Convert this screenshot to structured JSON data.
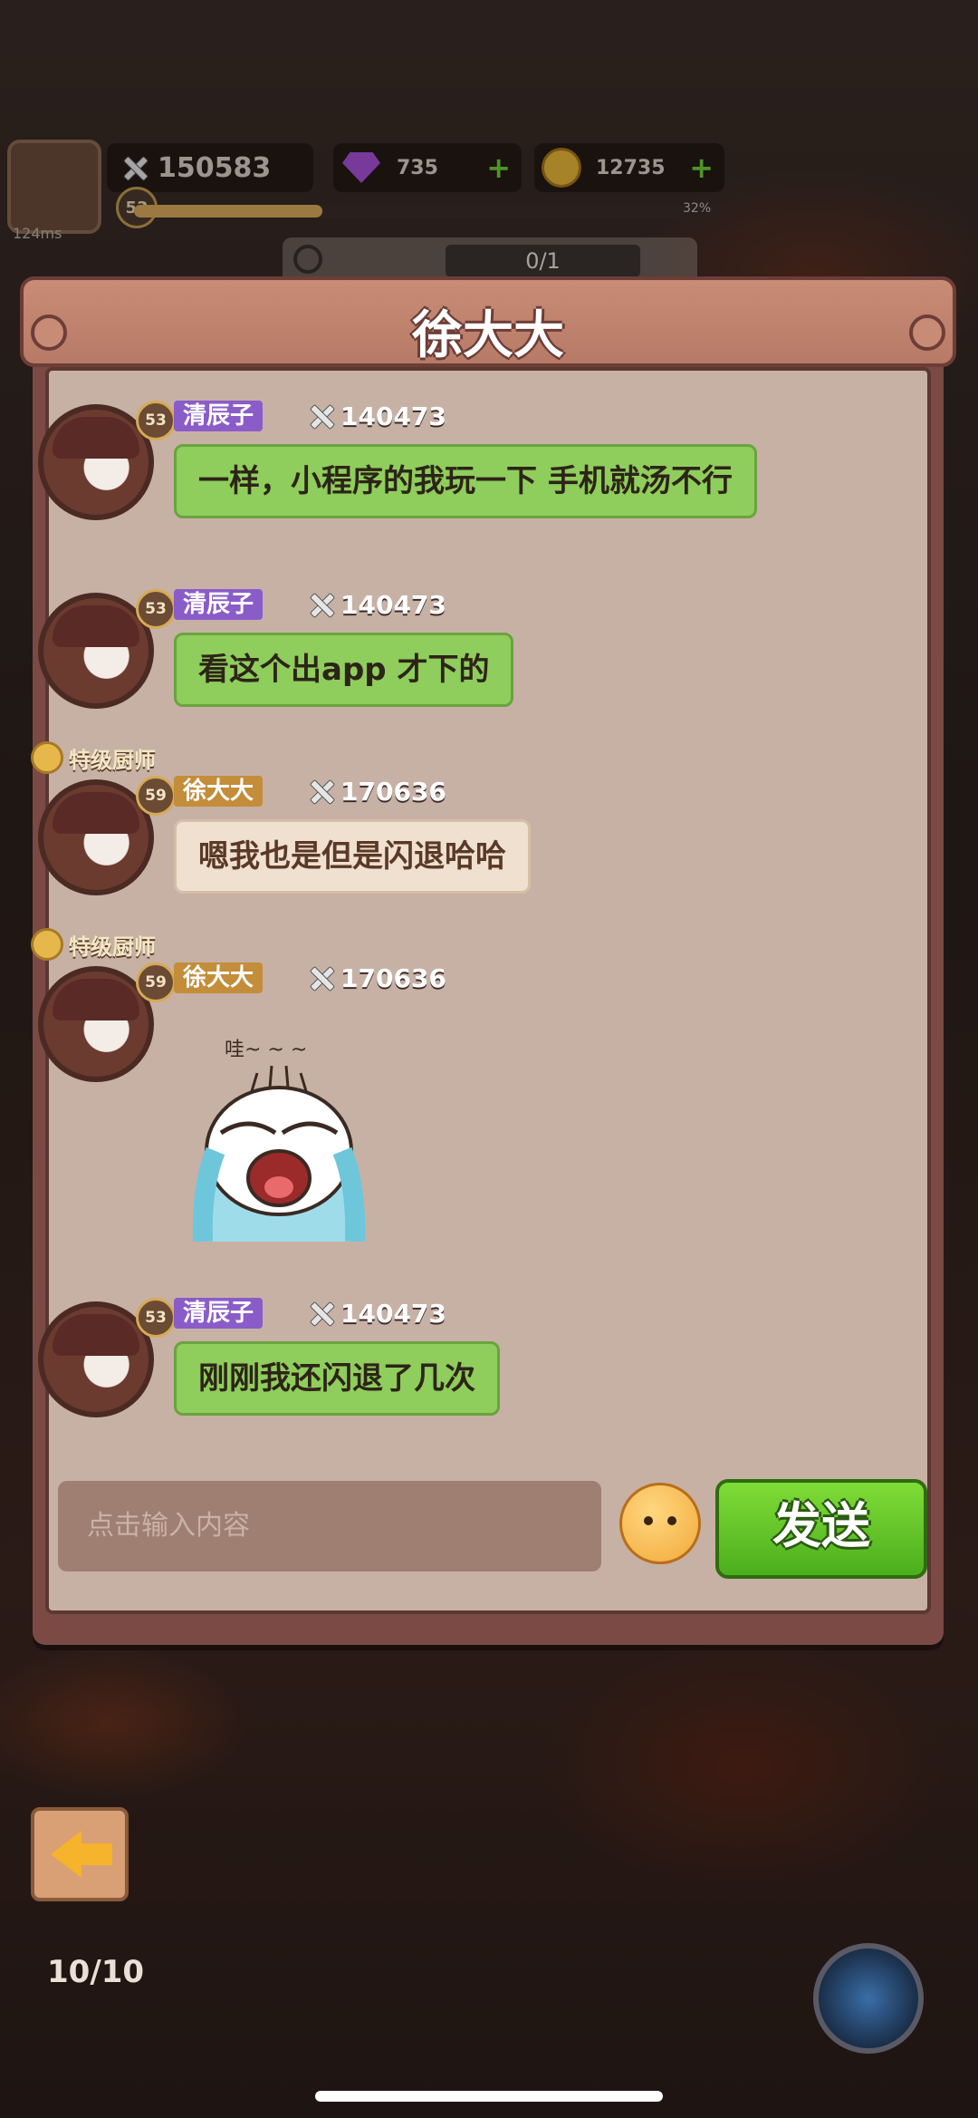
{
  "hud": {
    "power": "150583",
    "gems": "735",
    "coins": "12735",
    "level": "53",
    "progress_pct": "32%",
    "progress_value": 0.32,
    "ping": "124ms",
    "quest_progress": "0/1"
  },
  "chat": {
    "title": "徐大大",
    "messages": [
      {
        "sender": "清辰子",
        "level": "53",
        "power": "140473",
        "text": "一样，小程序的我玩一下 手机就汤不行"
      },
      {
        "sender": "清辰子",
        "level": "53",
        "power": "140473",
        "text": "看这个出app 才下的"
      },
      {
        "sender": "徐大大",
        "level": "59",
        "power": "170636",
        "title": "特级厨师",
        "text": "嗯我也是但是闪退哈哈"
      },
      {
        "sender": "徐大大",
        "level": "59",
        "power": "170636",
        "title": "特级厨师",
        "sticker_caption": "哇~ ~ ~"
      },
      {
        "sender": "清辰子",
        "level": "53",
        "power": "140473",
        "text": "刚刚我还闪退了几次"
      }
    ],
    "input_placeholder": "点击输入内容",
    "send_label": "发送"
  },
  "bottom": {
    "party_count": "10/10"
  },
  "colors": {
    "accent_green": "#7fdc37",
    "panel_brown": "#7b4a44",
    "bubble_green": "#8fcd5c"
  }
}
